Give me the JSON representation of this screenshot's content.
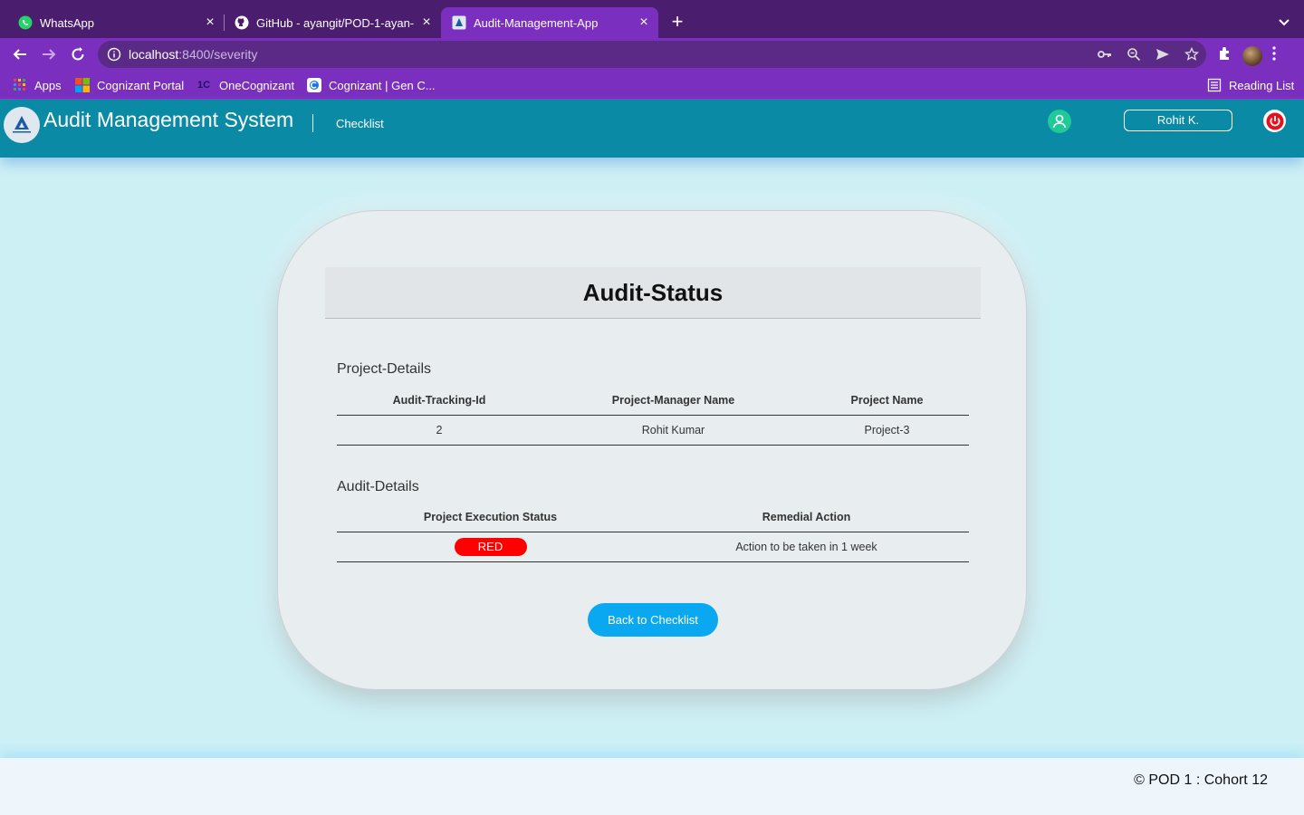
{
  "browser": {
    "tabs": [
      {
        "title": "WhatsApp",
        "icon": "whatsapp-icon",
        "active": false
      },
      {
        "title": "GitHub - ayangit/POD-1-ayan-",
        "icon": "github-icon",
        "active": false
      },
      {
        "title": "Audit-Management-App",
        "icon": "app-favicon",
        "active": true
      }
    ],
    "url_host": "localhost",
    "url_path": ":8400/severity",
    "bookmarks": [
      {
        "label": "Apps",
        "icon": "apps-grid-icon"
      },
      {
        "label": "Cognizant Portal",
        "icon": "microsoft-icon"
      },
      {
        "label": "OneCognizant",
        "icon": "onecognizant-icon"
      },
      {
        "label": "Cognizant | Gen C...",
        "icon": "genc-icon"
      }
    ],
    "reading_list": "Reading List"
  },
  "header": {
    "title": "Audit Management System",
    "nav_checklist": "Checklist",
    "user_name": "Rohit K.",
    "accent_color": "#0a8aa5"
  },
  "card": {
    "title": "Audit-Status",
    "project_section": "Project-Details",
    "project_columns": [
      "Audit-Tracking-Id",
      "Project-Manager Name",
      "Project Name"
    ],
    "project_row": [
      "2",
      "Rohit Kumar",
      "Project-3"
    ],
    "audit_section": "Audit-Details",
    "audit_columns": [
      "Project Execution Status",
      "Remedial Action"
    ],
    "audit_row": {
      "status": "RED",
      "status_color": "#ff0000",
      "action": "Action to be taken in 1 week"
    },
    "back_button": "Back to Checklist"
  },
  "footer": {
    "text": "© POD 1 : Cohort 12"
  }
}
